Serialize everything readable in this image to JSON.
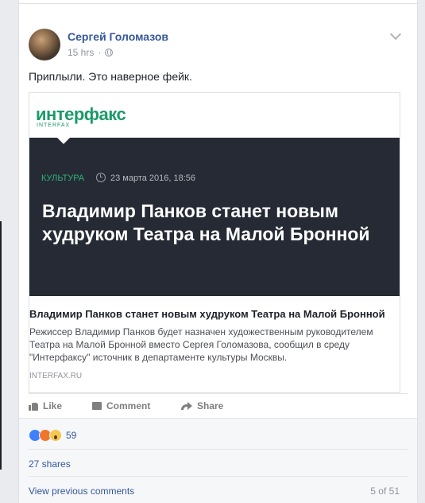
{
  "post": {
    "author": "Сергей Голомазов",
    "time": "15 hrs",
    "separator": "·",
    "privacy_icon": "globe-icon",
    "text": "Приплыли. Это наверное фейк."
  },
  "link_preview": {
    "logo": "интерфакс",
    "logo_sub": "INTERFAX",
    "category": "КУЛЬТУРА",
    "date": "23 марта 2016, 18:56",
    "headline": "Владимир Панков станет новым худруком Театра на Малой Бронной",
    "title": "Владимир Панков станет новым худруком Театра на Малой Бронной",
    "description": "Режиссер Владимир Панков будет назначен художественным руководителем Театра на Малой Бронной вместо Сергея Голомазова, сообщил в среду \"Интерфаксу\" источник в департаменте культуры Москвы.",
    "domain": "INTERFAX.RU"
  },
  "actions": {
    "like": "Like",
    "comment": "Comment",
    "share": "Share"
  },
  "footer": {
    "reaction_count": "59",
    "shares": "27 shares",
    "view_previous": "View previous comments",
    "pager": "5 of 51"
  },
  "colors": {
    "link_blue": "#365899",
    "interfax_green": "#1b9a69",
    "banner_dark": "#262a35"
  }
}
